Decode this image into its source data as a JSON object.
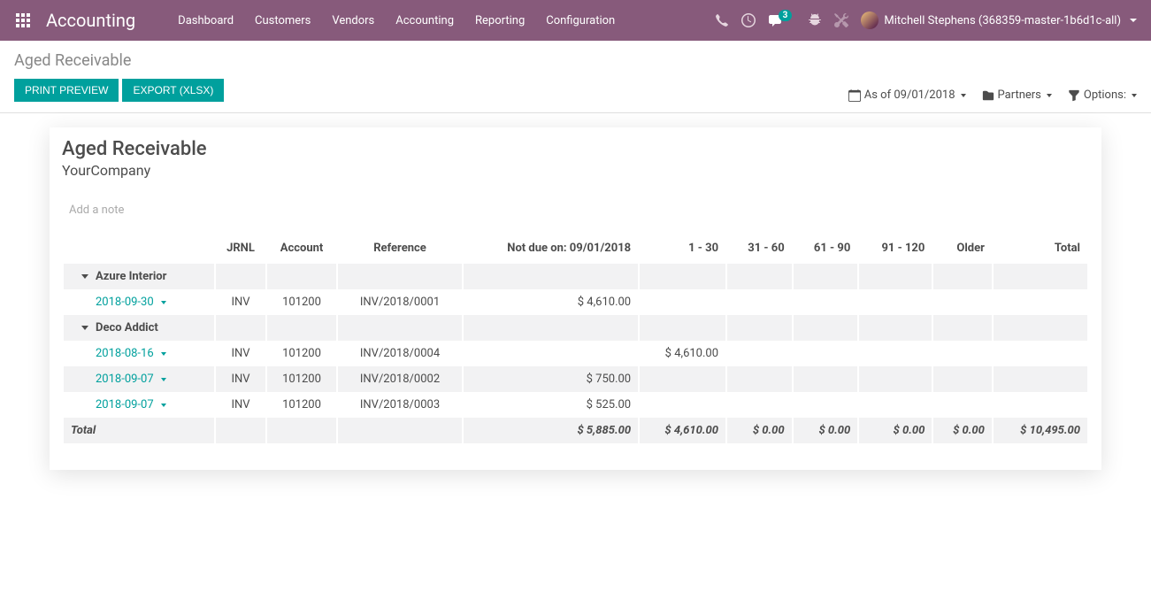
{
  "navbar": {
    "brand": "Accounting",
    "menu": [
      "Dashboard",
      "Customers",
      "Vendors",
      "Accounting",
      "Reporting",
      "Configuration"
    ],
    "messages_badge": "3",
    "user_name": "Mitchell Stephens (368359-master-1b6d1c-all)"
  },
  "control_panel": {
    "breadcrumb": "Aged Receivable",
    "btn_print": "PRINT PREVIEW",
    "btn_export": "EXPORT (XLSX)",
    "filter_date": "As of 09/01/2018",
    "filter_partners": "Partners",
    "filter_options": "Options:"
  },
  "report": {
    "title": "Aged Receivable",
    "company": "YourCompany",
    "add_note": "Add a note",
    "headers": [
      "",
      "JRNL",
      "Account",
      "Reference",
      "Not due on: 09/01/2018",
      "1 - 30",
      "31 - 60",
      "61 - 90",
      "91 - 120",
      "Older",
      "Total"
    ],
    "groups": [
      {
        "partner": "Azure Interior",
        "lines": [
          {
            "date": "2018-09-30",
            "jrnl": "INV",
            "account": "101200",
            "ref": "INV/2018/0001",
            "not_due": "$ 4,610.00",
            "c1": "",
            "c2": "",
            "c3": "",
            "c4": "",
            "older": "",
            "total": ""
          }
        ]
      },
      {
        "partner": "Deco Addict",
        "lines": [
          {
            "date": "2018-08-16",
            "jrnl": "INV",
            "account": "101200",
            "ref": "INV/2018/0004",
            "not_due": "",
            "c1": "$ 4,610.00",
            "c2": "",
            "c3": "",
            "c4": "",
            "older": "",
            "total": ""
          },
          {
            "date": "2018-09-07",
            "jrnl": "INV",
            "account": "101200",
            "ref": "INV/2018/0002",
            "not_due": "$ 750.00",
            "c1": "",
            "c2": "",
            "c3": "",
            "c4": "",
            "older": "",
            "total": ""
          },
          {
            "date": "2018-09-07",
            "jrnl": "INV",
            "account": "101200",
            "ref": "INV/2018/0003",
            "not_due": "$ 525.00",
            "c1": "",
            "c2": "",
            "c3": "",
            "c4": "",
            "older": "",
            "total": ""
          }
        ]
      }
    ],
    "total": {
      "label": "Total",
      "not_due": "$ 5,885.00",
      "c1": "$ 4,610.00",
      "c2": "$ 0.00",
      "c3": "$ 0.00",
      "c4": "$ 0.00",
      "older": "$ 0.00",
      "total": "$ 10,495.00"
    }
  }
}
